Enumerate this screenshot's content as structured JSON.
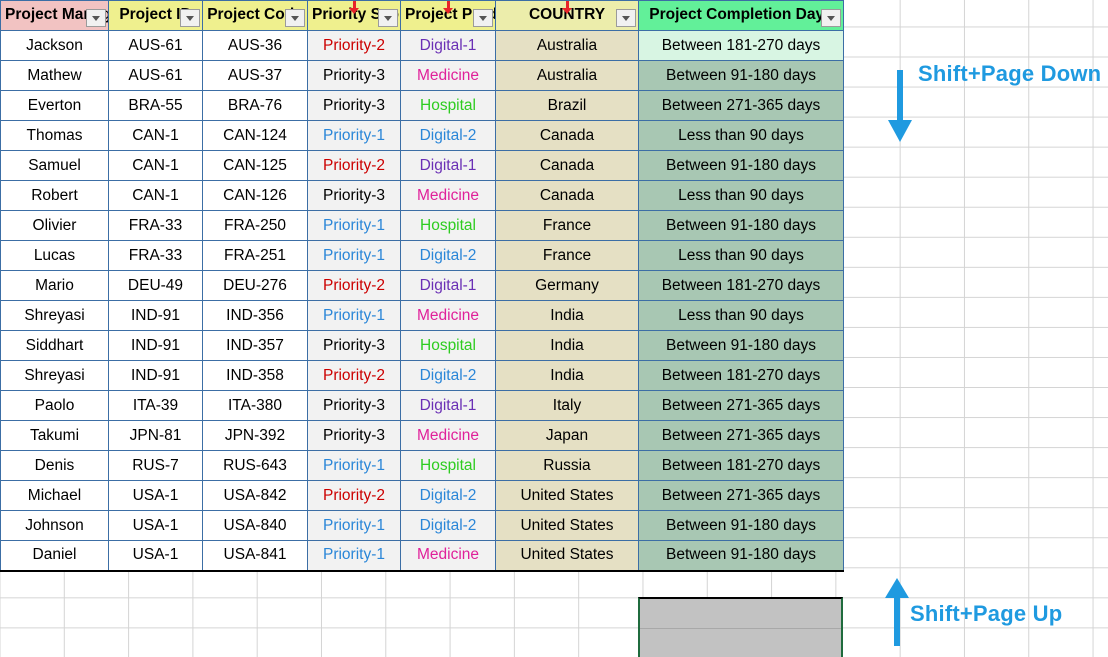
{
  "table": {
    "headers": [
      {
        "label": "Project Manager",
        "key": "manager",
        "bg": "#f2c3c2",
        "filter": true,
        "red_arrow": false
      },
      {
        "label": "Project ID",
        "key": "id",
        "bg": "#eff08e",
        "filter": true,
        "red_arrow": false
      },
      {
        "label": "Project Code",
        "key": "code",
        "bg": "#eff08e",
        "filter": true,
        "red_arrow": false
      },
      {
        "label": "Priority Scope",
        "key": "priority",
        "bg": "#eff08e",
        "filter": true,
        "red_arrow": true
      },
      {
        "label": "Project Product",
        "key": "product",
        "bg": "#eff08e",
        "filter": true,
        "red_arrow": true
      },
      {
        "label": "COUNTRY",
        "key": "country",
        "bg": "#ecedab",
        "filter": true,
        "red_arrow": true
      },
      {
        "label": "Project Completion Days",
        "key": "days",
        "bg": "#62f099",
        "filter": true,
        "red_arrow": false
      }
    ],
    "rows": [
      {
        "manager": "Jackson",
        "id": "AUS-61",
        "code": "AUS-36",
        "priority": "Priority-2",
        "product": "Digital-1",
        "country": "Australia",
        "days": "Between 181-270 days"
      },
      {
        "manager": "Mathew",
        "id": "AUS-61",
        "code": "AUS-37",
        "priority": "Priority-3",
        "product": "Medicine",
        "country": "Australia",
        "days": "Between 91-180 days"
      },
      {
        "manager": "Everton",
        "id": "BRA-55",
        "code": "BRA-76",
        "priority": "Priority-3",
        "product": "Hospital",
        "country": "Brazil",
        "days": "Between 271-365 days"
      },
      {
        "manager": "Thomas",
        "id": "CAN-1",
        "code": "CAN-124",
        "priority": "Priority-1",
        "product": "Digital-2",
        "country": "Canada",
        "days": "Less than 90 days"
      },
      {
        "manager": "Samuel",
        "id": "CAN-1",
        "code": "CAN-125",
        "priority": "Priority-2",
        "product": "Digital-1",
        "country": "Canada",
        "days": "Between 91-180 days"
      },
      {
        "manager": "Robert",
        "id": "CAN-1",
        "code": "CAN-126",
        "priority": "Priority-3",
        "product": "Medicine",
        "country": "Canada",
        "days": "Less than 90 days"
      },
      {
        "manager": "Olivier",
        "id": "FRA-33",
        "code": "FRA-250",
        "priority": "Priority-1",
        "product": "Hospital",
        "country": "France",
        "days": "Between 91-180 days"
      },
      {
        "manager": "Lucas",
        "id": "FRA-33",
        "code": "FRA-251",
        "priority": "Priority-1",
        "product": "Digital-2",
        "country": "France",
        "days": "Less than 90 days"
      },
      {
        "manager": "Mario",
        "id": "DEU-49",
        "code": "DEU-276",
        "priority": "Priority-2",
        "product": "Digital-1",
        "country": "Germany",
        "days": "Between 181-270 days"
      },
      {
        "manager": "Shreyasi",
        "id": "IND-91",
        "code": "IND-356",
        "priority": "Priority-1",
        "product": "Medicine",
        "country": "India",
        "days": "Less than 90 days"
      },
      {
        "manager": "Siddhart",
        "id": "IND-91",
        "code": "IND-357",
        "priority": "Priority-3",
        "product": "Hospital",
        "country": "India",
        "days": "Between 91-180 days"
      },
      {
        "manager": "Shreyasi",
        "id": "IND-91",
        "code": "IND-358",
        "priority": "Priority-2",
        "product": "Digital-2",
        "country": "India",
        "days": "Between 181-270 days"
      },
      {
        "manager": "Paolo",
        "id": "ITA-39",
        "code": "ITA-380",
        "priority": "Priority-3",
        "product": "Digital-1",
        "country": "Italy",
        "days": "Between 271-365 days"
      },
      {
        "manager": "Takumi",
        "id": "JPN-81",
        "code": "JPN-392",
        "priority": "Priority-3",
        "product": "Medicine",
        "country": "Japan",
        "days": "Between 271-365 days"
      },
      {
        "manager": "Denis",
        "id": "RUS-7",
        "code": "RUS-643",
        "priority": "Priority-1",
        "product": "Hospital",
        "country": "Russia",
        "days": "Between 181-270 days"
      },
      {
        "manager": "Michael",
        "id": "USA-1",
        "code": "USA-842",
        "priority": "Priority-2",
        "product": "Digital-2",
        "country": "United States",
        "days": "Between 271-365 days"
      },
      {
        "manager": "Johnson",
        "id": "USA-1",
        "code": "USA-840",
        "priority": "Priority-1",
        "product": "Digital-2",
        "country": "United States",
        "days": "Between 91-180 days"
      },
      {
        "manager": "Daniel",
        "id": "USA-1",
        "code": "USA-841",
        "priority": "Priority-1",
        "product": "Medicine",
        "country": "United States",
        "days": "Between 91-180 days"
      }
    ]
  },
  "text_colors": {
    "Priority-1": "#2a86d8",
    "Priority-2": "#cc0000",
    "Priority-3": "#000000",
    "Digital-1": "#6a2fb5",
    "Digital-2": "#2a86d8",
    "Medicine": "#e0219a",
    "Hospital": "#2ecc1f"
  },
  "annotations": {
    "shift_page_down": "Shift+Page Down",
    "shift_page_up": "Shift+Page Up",
    "color": "#1f9ae0"
  }
}
